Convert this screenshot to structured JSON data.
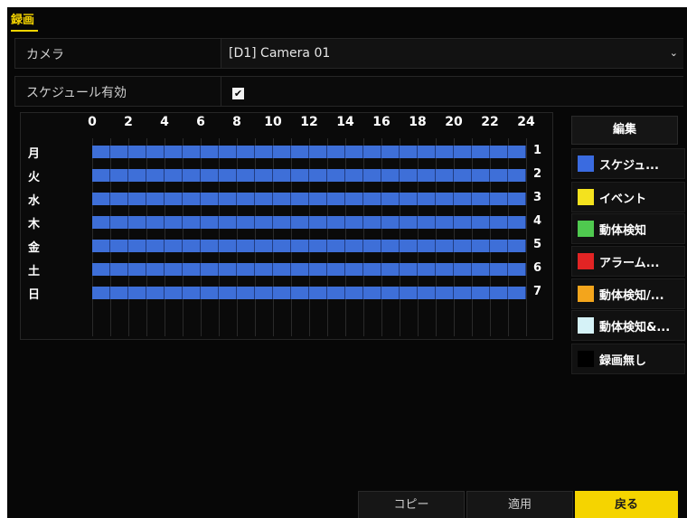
{
  "tab": {
    "label": "録画"
  },
  "camera": {
    "label": "カメラ",
    "value": "[D1] Camera 01"
  },
  "schedule_enable": {
    "label": "スケジュール有効",
    "checked": true,
    "check_glyph": "✔"
  },
  "grid": {
    "hours": [
      "0",
      "2",
      "4",
      "6",
      "8",
      "10",
      "12",
      "14",
      "16",
      "18",
      "20",
      "22",
      "24"
    ],
    "days": [
      {
        "label": "月",
        "num": "1"
      },
      {
        "label": "火",
        "num": "2"
      },
      {
        "label": "水",
        "num": "3"
      },
      {
        "label": "木",
        "num": "4"
      },
      {
        "label": "金",
        "num": "5"
      },
      {
        "label": "土",
        "num": "6"
      },
      {
        "label": "日",
        "num": "7"
      }
    ],
    "bar_color": "#3e6fd8"
  },
  "edit_button": {
    "label": "編集"
  },
  "legend": [
    {
      "label": "スケジュ...",
      "color": "#3a6be0"
    },
    {
      "label": "イベント",
      "color": "#f4e21e"
    },
    {
      "label": "動体検知",
      "color": "#4fc94f"
    },
    {
      "label": "アラーム...",
      "color": "#e22424"
    },
    {
      "label": "動体検知/...",
      "color": "#f3a51c"
    },
    {
      "label": "動体検知&...",
      "color": "#d5f2f7"
    },
    {
      "label": "録画無し",
      "color": "#000000"
    }
  ],
  "footer": {
    "copy": "コピー",
    "apply": "適用",
    "back": "戻る"
  }
}
